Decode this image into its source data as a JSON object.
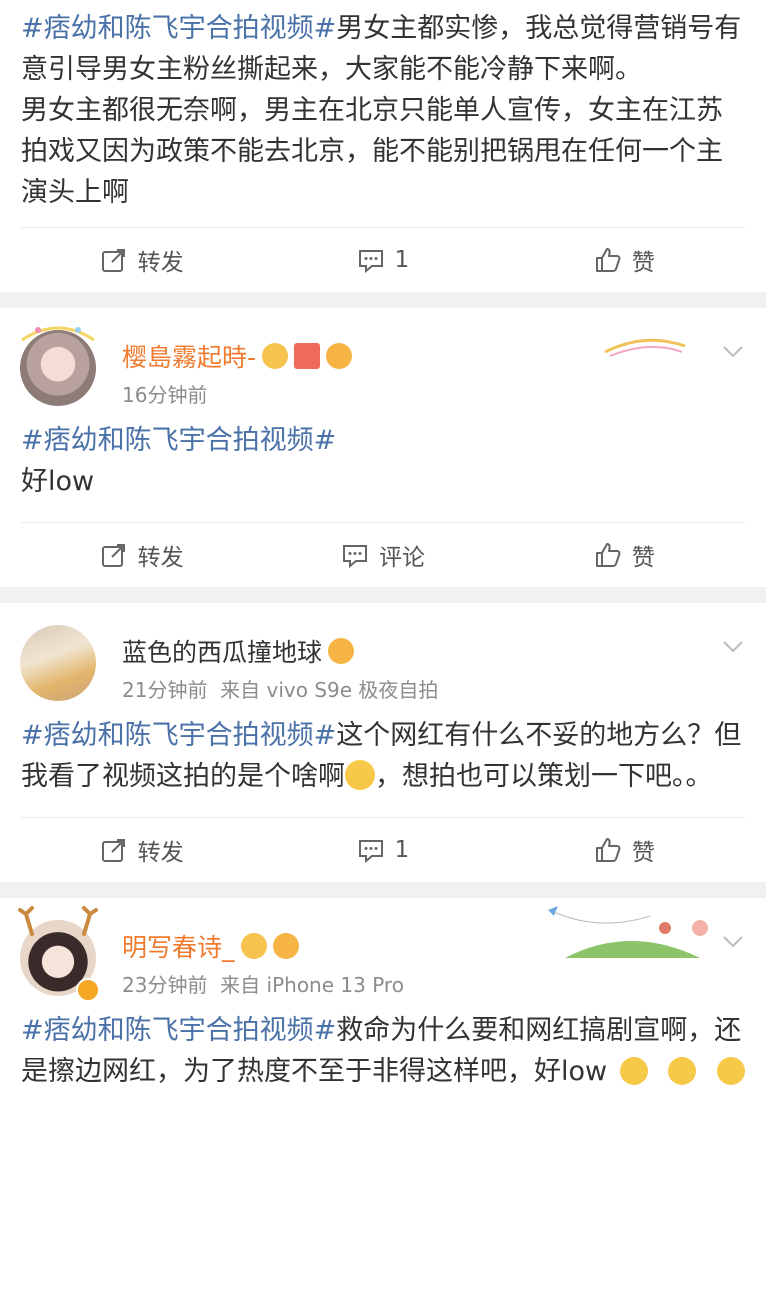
{
  "posts": [
    {
      "content_prefix": "#痞幼和陈飞宇合拍视频#",
      "content_rest": "男女主都实惨，我总觉得营销号有意引导男女主粉丝撕起来，大家能不能冷静下来啊。",
      "content_p2": "男女主都很无奈啊，男主在北京只能单人宣传，女主在江苏拍戏又因为政策不能去北京，能不能别把锅甩在任何一个主演头上啊",
      "repost_label": "转发",
      "comment_label": "1",
      "like_label": "赞"
    },
    {
      "username": "樱島霧起時-",
      "time": "16分钟前",
      "source": "",
      "content_prefix": "#痞幼和陈飞宇合拍视频#",
      "content_rest": "好low",
      "repost_label": "转发",
      "comment_label": "评论",
      "like_label": "赞"
    },
    {
      "username": "蓝色的西瓜撞地球",
      "time": "21分钟前",
      "source": "来自 vivo S9e 极夜自拍",
      "content_prefix": "#痞幼和陈飞宇合拍视频#",
      "content_rest": "这个网红有什么不妥的地方么？但我看了视频这拍的是个啥啊",
      "content_tail": "，想拍也可以策划一下吧。。",
      "repost_label": "转发",
      "comment_label": "1",
      "like_label": "赞"
    },
    {
      "username": "明写春诗_",
      "time": "23分钟前",
      "source": "来自 iPhone 13 Pro",
      "content_prefix": "#痞幼和陈飞宇合拍视频#",
      "content_rest": "救命为什么要和网红搞剧宣啊，还是擦边网红，为了热度不至于非得这样吧，好low"
    }
  ],
  "icons": {
    "repost": "repost-icon",
    "comment": "comment-icon",
    "like": "thumbs-up-icon",
    "chevron": "chevron-down-icon"
  },
  "colors": {
    "hashtag": "#4a72a8",
    "vip_name": "#f07b2f"
  }
}
